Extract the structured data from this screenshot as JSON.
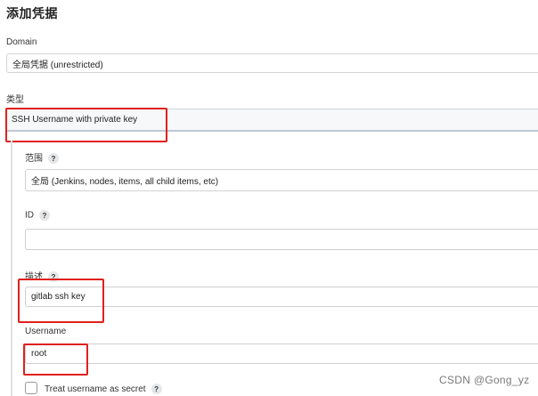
{
  "page": {
    "title": "添加凭据"
  },
  "domain": {
    "label": "Domain",
    "value": "全局凭据 (unrestricted)"
  },
  "kind": {
    "label": "类型",
    "value": "SSH Username with private key"
  },
  "scope": {
    "label": "范围",
    "value": "全局 (Jenkins, nodes, items, all child items, etc)",
    "help": "?"
  },
  "id_field": {
    "label": "ID",
    "value": "",
    "help": "?"
  },
  "description": {
    "label": "描述",
    "value": "gitlab ssh key",
    "help": "?"
  },
  "username": {
    "label": "Username",
    "value": "root"
  },
  "treat_secret": {
    "label": "Treat username as secret",
    "help": "?",
    "checked": false
  },
  "watermark": {
    "text": "CSDN @Gong_yz"
  },
  "colors": {
    "highlight": "#e0201d",
    "border": "#d3d3d3"
  },
  "icons": {
    "help": "question-mark-icon"
  }
}
